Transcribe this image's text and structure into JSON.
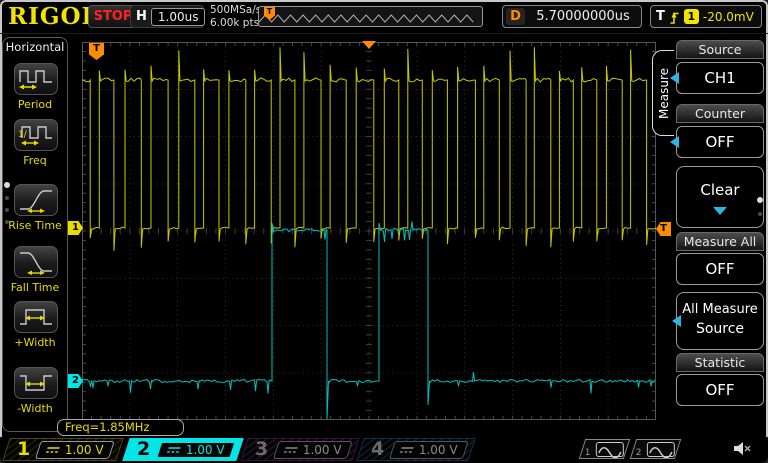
{
  "top_bar": {
    "logo": "RIGOL",
    "run_state": "STOP",
    "horizontal_label": "H",
    "timebase": "1.00us",
    "sample_rate": "500MSa/s",
    "memory_depth": "6.00k pts",
    "memory_trigger_flag": "T",
    "delay_label": "D",
    "delay_value": "5.70000000us",
    "trigger_label": "T",
    "trigger_source_badge": "1",
    "trigger_level": "-20.0mV"
  },
  "left_menu": {
    "title": "Horizontal",
    "items": [
      {
        "label": "Period",
        "icon": "period-icon"
      },
      {
        "label": "Freq",
        "icon": "freq-icon"
      },
      {
        "label": "Rise Time",
        "icon": "rise-time-icon"
      },
      {
        "label": "Fall Time",
        "icon": "fall-time-icon"
      },
      {
        "label": "+Width",
        "icon": "plus-width-icon"
      },
      {
        "label": "-Width",
        "icon": "minus-width-icon"
      }
    ]
  },
  "right_menu": {
    "tab": "Measure",
    "items": [
      {
        "label": "Source",
        "value": "CH1"
      },
      {
        "label": "Counter",
        "value": "OFF"
      },
      {
        "label": "Clear"
      },
      {
        "label": "Measure All",
        "value": "OFF"
      },
      {
        "label_line1": "All Measure",
        "label_line2": "Source"
      },
      {
        "label": "Statistic",
        "value": "OFF"
      }
    ]
  },
  "measurement": {
    "freq_readout": "Freq=1.85MHz"
  },
  "plot": {
    "trigger_flag_label": "T",
    "ch1_ground_tag": "1",
    "ch2_ground_tag": "2",
    "trigger_level_tag": "T"
  },
  "channels": [
    {
      "num": "1",
      "coupling": "DC",
      "scale": "1.00 V",
      "color": "#e8dc00",
      "state": "on"
    },
    {
      "num": "2",
      "coupling": "DC",
      "scale": "1.00 V",
      "color": "#00e6e6",
      "state": "selected"
    },
    {
      "num": "3",
      "coupling": "DC",
      "scale": "1.00 V",
      "color": "#b14fb1",
      "state": "off"
    },
    {
      "num": "4",
      "coupling": "DC",
      "scale": "1.00 V",
      "color": "#4f7fb1",
      "state": "off"
    }
  ],
  "bottom_bar": {
    "source_buttons": [
      {
        "num": "1"
      },
      {
        "num": "2"
      }
    ],
    "speaker_muted": true
  },
  "waveforms": {
    "ch1": {
      "color": "#c6c800",
      "high": 38,
      "low": 186,
      "period": 25.5,
      "duty": 0.62,
      "tall_pulses": [
        4,
        8,
        9,
        13,
        17,
        18,
        22
      ]
    },
    "ch2": {
      "color": "#00bfbf",
      "low": 339,
      "high": 188,
      "bursts": [
        [
          190,
          245
        ],
        [
          297,
          346
        ]
      ],
      "deep": [
        377,
        363
      ]
    }
  },
  "colors": {
    "accent_orange": "#ff8c00",
    "ch1_yellow": "#f0e400",
    "ch2_cyan": "#00e6e6",
    "menu_arrow_blue": "#2fb3e3",
    "stop_red": "#ff2222",
    "grid_gray": "#2d2d2d"
  }
}
